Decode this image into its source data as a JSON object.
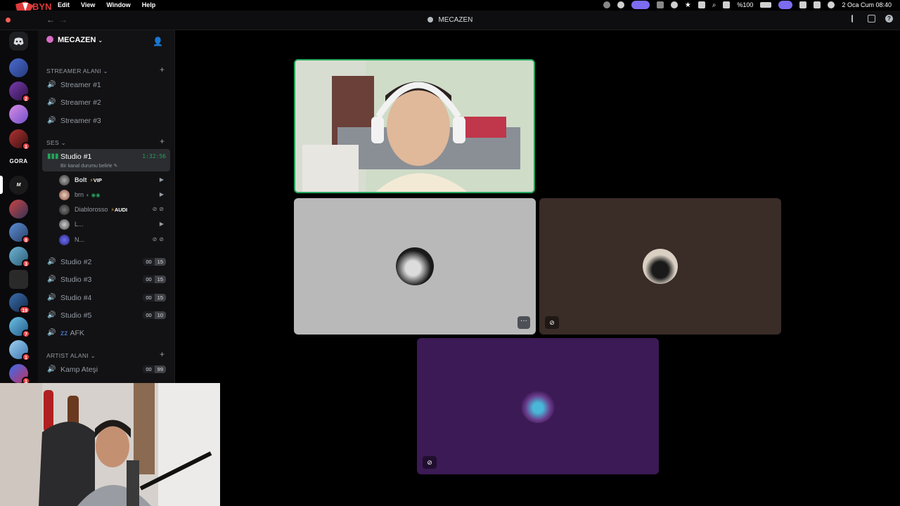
{
  "menubar": {
    "items": [
      "Edit",
      "View",
      "Window",
      "Help"
    ],
    "battery": "%100",
    "datetime": "2 Oca Cum  08:40"
  },
  "titlebar": {
    "title": "MECAZEN"
  },
  "rail": {
    "badges": [
      "2",
      "1",
      "8",
      "3",
      "19",
      "7",
      "1",
      "1"
    ],
    "gora_label": "GORA"
  },
  "server": {
    "name": "MECAZEN"
  },
  "categories": {
    "streamer": "STREAMER ALANI",
    "ses": "SES",
    "artist": "ARTIST ALANI"
  },
  "channels": {
    "streamer": [
      "Streamer #1",
      "Streamer #2",
      "Streamer #3"
    ],
    "studio1": {
      "name": "Studio #1",
      "timer": "1:32:56",
      "status": "Bir kanal durumu belirle"
    },
    "studio2": {
      "name": "Studio #2",
      "count": "00",
      "limit": "15"
    },
    "studio3": {
      "name": "Studio #3",
      "count": "00",
      "limit": "15"
    },
    "studio4": {
      "name": "Studio #4",
      "count": "00",
      "limit": "15"
    },
    "studio5": {
      "name": "Studio #5",
      "count": "00",
      "limit": "10"
    },
    "afk": {
      "name": "AFK"
    },
    "kamp": {
      "name": "Kamp Ateşi",
      "count": "00",
      "limit": "99"
    }
  },
  "members": [
    {
      "name": "Bolt",
      "tag": "VIP"
    },
    {
      "name": "brn",
      "tag": ""
    },
    {
      "name": "Diablorosso",
      "tag": "AUDI"
    },
    {
      "name": "L...",
      "tag": ""
    },
    {
      "name": "N...",
      "tag": ""
    }
  ],
  "colors": {
    "accent_green": "#23a55a",
    "tile_gray": "#b8b8b8",
    "tile_brown": "#3a2c27",
    "tile_purple": "#3b1a55",
    "menubar_pill": "#7c6cf0"
  },
  "icons": {
    "speaker": "speaker-icon",
    "mute": "deafened-icon",
    "camera": "camera-icon",
    "more": "more-icon"
  }
}
